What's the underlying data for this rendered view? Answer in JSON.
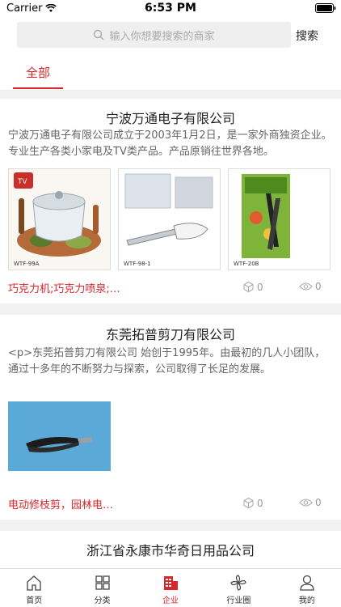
{
  "status_bar": {
    "carrier": "Carrier",
    "time": "6:53 PM"
  },
  "search": {
    "placeholder": "输入你想要搜索的商家",
    "button_label": "搜索"
  },
  "tabs": [
    {
      "label": "全部",
      "active": true
    }
  ],
  "companies": [
    {
      "title": "宁波万通电子有限公司",
      "description": "宁波万通电子有限公司成立于2003年1月2日，是一家外商独资企业。专业生产各类小家电及TV类产品。产品原销往世界各地。",
      "images": [
        {
          "label": "WTF-99A"
        },
        {
          "label": "WTF-98-1"
        },
        {
          "label": "WTF-20B"
        }
      ],
      "tags": "巧克力机;巧克力喷泉;…",
      "favorites": "0",
      "views": "0"
    },
    {
      "title": "东莞拓普剪刀有限公司",
      "description": "<p>东莞拓普剪刀有限公司 始创于1995年。由最初的几人小团队，通过十多年的不断努力与探索，公司取得了长足的发展。",
      "images": [],
      "tags": "电动修枝剪，园林电…",
      "favorites": "0",
      "views": "0"
    },
    {
      "title": "浙江省永康市华奇日用品公司",
      "description": ""
    }
  ],
  "bottom_nav": [
    {
      "label": "首页",
      "icon": "home-icon"
    },
    {
      "label": "分类",
      "icon": "grid-icon"
    },
    {
      "label": "企业",
      "icon": "enterprise-icon",
      "active": true
    },
    {
      "label": "行业圈",
      "icon": "pinwheel-icon"
    },
    {
      "label": "我的",
      "icon": "user-icon"
    }
  ],
  "colors": {
    "accent": "#d9262b",
    "background": "#f2f2f2"
  }
}
